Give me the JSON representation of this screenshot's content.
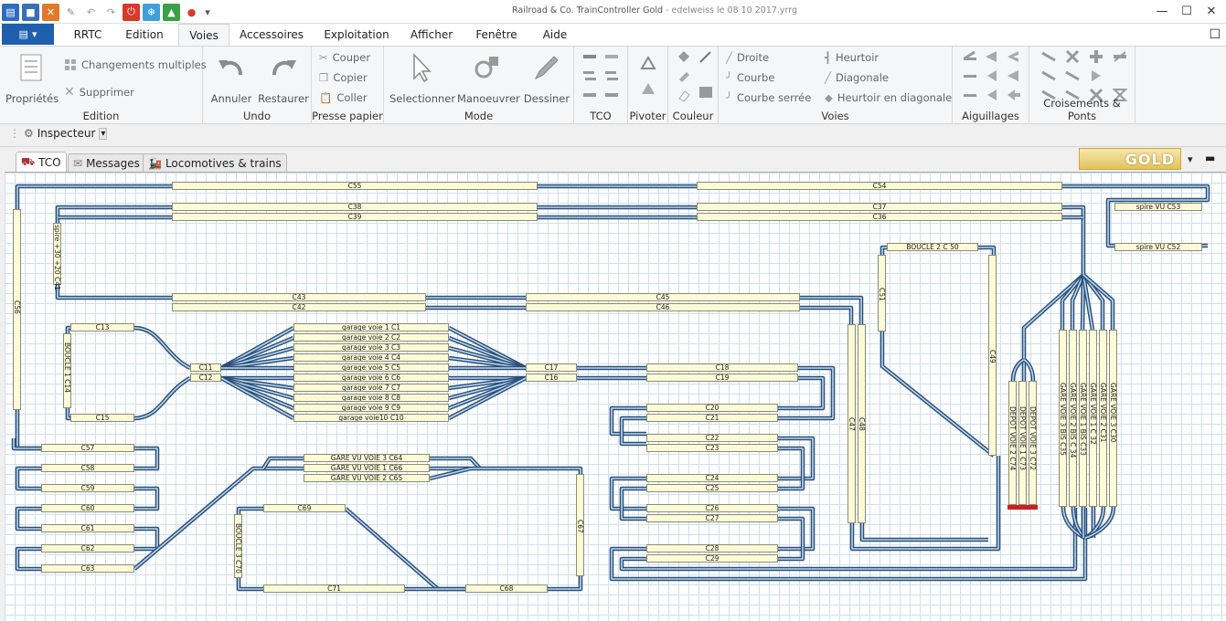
{
  "window": {
    "app_title": "Railroad & Co. TrainController Gold",
    "separator": " - ",
    "file_title": "edelweiss le 08 10 2017.yrrg"
  },
  "ribbon_tabs": [
    "RRTC",
    "Edition",
    "Voies",
    "Accessoires",
    "Exploitation",
    "Afficher",
    "Fenêtre",
    "Aide"
  ],
  "active_tab": "Voies",
  "ribbon": {
    "edition": {
      "label": "Edition",
      "proprietes": "Propriétés",
      "changements": "Changements multiples",
      "supprimer": "Supprimer"
    },
    "undo": {
      "label": "Undo",
      "annuler": "Annuler",
      "restaurer": "Restaurer"
    },
    "clipboard": {
      "label": "Presse papier",
      "couper": "Couper",
      "copier": "Copier",
      "coller": "Coller"
    },
    "mode": {
      "label": "Mode",
      "selectionner": "Selectionner",
      "manoeuvrer": "Manoeuvrer",
      "dessiner": "Dessiner"
    },
    "tco": {
      "label": "TCO"
    },
    "pivoter": {
      "label": "Pivoter"
    },
    "couleur": {
      "label": "Couleur"
    },
    "voies": {
      "label": "Voies",
      "droite": "Droite",
      "courbe": "Courbe",
      "courbe_serree": "Courbe serrée",
      "heurtoir": "Heurtoir",
      "diagonale": "Diagonale",
      "heurtoir_diag": "Heurtoir en diagonale"
    },
    "aiguillages": {
      "label": "Aiguillages"
    },
    "croisements": {
      "label": "Croisements & Ponts"
    }
  },
  "inspector": {
    "label": "Inspecteur"
  },
  "doc_tabs": {
    "tco": "TCO",
    "messages": "Messages",
    "locos": "Locomotives & trains"
  },
  "gold_logo": "GOLD",
  "colors": {
    "accent": "#1f5fad",
    "track_fill": "#bcd6ee",
    "track_edge": "#2b4f78",
    "block_fill": "#fcfbd8"
  },
  "blocks": {
    "c55": "C55",
    "c54": "C54",
    "c38": "C38",
    "c37": "C37",
    "c39": "C39",
    "c36": "C36",
    "c53": "spire VU C53",
    "c52": "spire VU C52",
    "c50": "BOUCLE 2 C 50",
    "c43": "C43",
    "c45": "C45",
    "c42": "C42",
    "c46": "C46",
    "c13": "C13",
    "c15": "C15",
    "c11": "C11",
    "c12": "C12",
    "g1": "garage voie 1  C1",
    "g2": "garage voie 2  C2",
    "g3": "garage voie 3  C3",
    "g4": "garage voie 4  C4",
    "g5": "garage voie 5  C5",
    "g6": "garage voie 6  C6",
    "g7": "garage voie 7  C7",
    "g8": "garage voie 8  C8",
    "g9": "garage voie 9  C9",
    "g10": "garage voie10  C10",
    "c17": "C17",
    "c16": "C16",
    "c18": "C18",
    "c19": "C19",
    "c20": "C20",
    "c21": "C21",
    "c22": "C22",
    "c23": "C23",
    "c24": "C24",
    "c25": "C25",
    "c26": "C26",
    "c27": "C27",
    "c28": "C28",
    "c29": "C29",
    "c57": "C57",
    "c58": "C58",
    "c59": "C59",
    "c60": "C60",
    "c61": "C61",
    "c62": "C62",
    "c63": "C63",
    "c64": "GARE VU VOIE 3  C64",
    "c66": "GARE VU VOIE 1  C66",
    "c65": "GARE VU VOIE 2  C65",
    "c69": "C69",
    "c71": "C71",
    "c68": "C68"
  },
  "vblocks": {
    "c56": "C56",
    "c41": "spire +30 +20 C41",
    "c14": "BOUCLE 1  C14",
    "c51": "C51",
    "c49": "C49",
    "c47": "C47",
    "c48": "C48",
    "c70": "BOUCLE 3 C70",
    "c67": "C67",
    "c74": "DEPOT VOIE 2 C74",
    "c73": "DEPOT VOIE 1 C73",
    "c72": "DEPOT VOIE 3 C72",
    "c35": "GARE VOIE 3 BIS C35",
    "c34": "GARE VOIE 2 BIS C 34",
    "c33": "GARE VOIE 1 BIS C33",
    "c32": "GARE VOIE 1 C 32",
    "c31": "GARE VOIE 2 C31",
    "c30": "GARE VOIE 3 C30"
  }
}
